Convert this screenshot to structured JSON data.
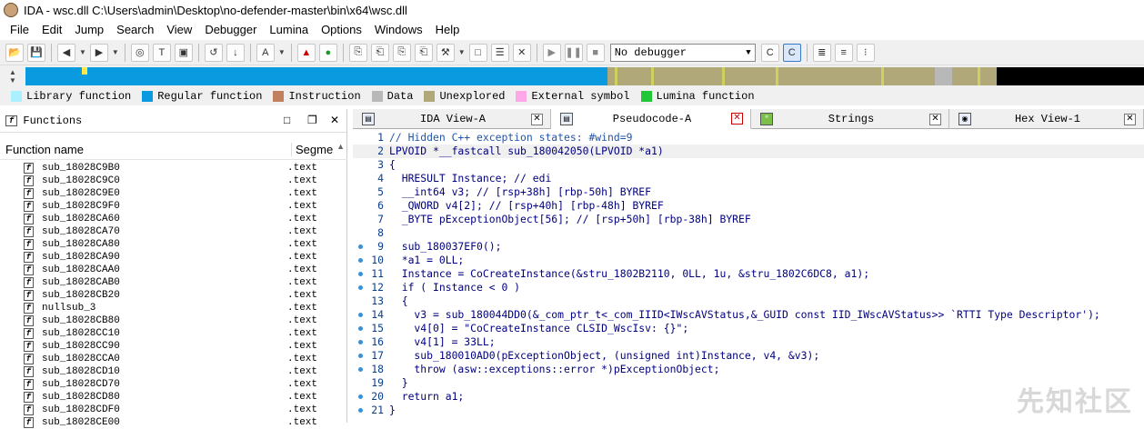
{
  "window": {
    "title": "IDA - wsc.dll C:\\Users\\admin\\Desktop\\no-defender-master\\bin\\x64\\wsc.dll"
  },
  "menu": [
    "File",
    "Edit",
    "Jump",
    "Search",
    "View",
    "Debugger",
    "Lumina",
    "Options",
    "Windows",
    "Help"
  ],
  "toolbar": {
    "debugger_value": "No debugger"
  },
  "legend": [
    {
      "label": "Library function",
      "color": "#aaf0ff"
    },
    {
      "label": "Regular function",
      "color": "#0a9ae0"
    },
    {
      "label": "Instruction",
      "color": "#c08060"
    },
    {
      "label": "Data",
      "color": "#b8b8b8"
    },
    {
      "label": "Unexplored",
      "color": "#b0a878"
    },
    {
      "label": "External symbol",
      "color": "#ffa8e8"
    },
    {
      "label": "Lumina function",
      "color": "#20c838"
    }
  ],
  "functions_panel": {
    "title": "Functions",
    "col_name": "Function name",
    "col_segment": "Segme",
    "rows": [
      {
        "name": "sub_18028C9B0",
        "seg": ".text"
      },
      {
        "name": "sub_18028C9C0",
        "seg": ".text"
      },
      {
        "name": "sub_18028C9E0",
        "seg": ".text"
      },
      {
        "name": "sub_18028C9F0",
        "seg": ".text"
      },
      {
        "name": "sub_18028CA60",
        "seg": ".text"
      },
      {
        "name": "sub_18028CA70",
        "seg": ".text"
      },
      {
        "name": "sub_18028CA80",
        "seg": ".text"
      },
      {
        "name": "sub_18028CA90",
        "seg": ".text"
      },
      {
        "name": "sub_18028CAA0",
        "seg": ".text"
      },
      {
        "name": "sub_18028CAB0",
        "seg": ".text"
      },
      {
        "name": "sub_18028CB20",
        "seg": ".text"
      },
      {
        "name": "nullsub_3",
        "seg": ".text"
      },
      {
        "name": "sub_18028CB80",
        "seg": ".text"
      },
      {
        "name": "sub_18028CC10",
        "seg": ".text"
      },
      {
        "name": "sub_18028CC90",
        "seg": ".text"
      },
      {
        "name": "sub_18028CCA0",
        "seg": ".text"
      },
      {
        "name": "sub_18028CD10",
        "seg": ".text"
      },
      {
        "name": "sub_18028CD70",
        "seg": ".text"
      },
      {
        "name": "sub_18028CD80",
        "seg": ".text"
      },
      {
        "name": "sub_18028CDF0",
        "seg": ".text"
      },
      {
        "name": "sub_18028CE00",
        "seg": ".text"
      }
    ]
  },
  "tabs": [
    {
      "label": "IDA View-A",
      "icon": "ida-view-icon",
      "active": false
    },
    {
      "label": "Pseudocode-A",
      "icon": "pseudocode-icon",
      "active": true
    },
    {
      "label": "Strings",
      "icon": "strings-icon",
      "active": false
    },
    {
      "label": "Hex View-1",
      "icon": "hex-view-icon",
      "active": false
    }
  ],
  "code_lines": [
    {
      "n": "1",
      "dot": false,
      "t": "// Hidden C++ exception states: #wind=9"
    },
    {
      "n": "2",
      "dot": false,
      "t": "LPVOID *__fastcall sub_180042050(LPVOID *a1)"
    },
    {
      "n": "3",
      "dot": false,
      "t": "{"
    },
    {
      "n": "4",
      "dot": false,
      "t": "  HRESULT Instance; // edi"
    },
    {
      "n": "5",
      "dot": false,
      "t": "  __int64 v3; // [rsp+38h] [rbp-50h] BYREF"
    },
    {
      "n": "6",
      "dot": false,
      "t": "  _QWORD v4[2]; // [rsp+40h] [rbp-48h] BYREF"
    },
    {
      "n": "7",
      "dot": false,
      "t": "  _BYTE pExceptionObject[56]; // [rsp+50h] [rbp-38h] BYREF"
    },
    {
      "n": "8",
      "dot": false,
      "t": ""
    },
    {
      "n": "9",
      "dot": true,
      "t": "  sub_180037EF0();"
    },
    {
      "n": "10",
      "dot": true,
      "t": "  *a1 = 0LL;"
    },
    {
      "n": "11",
      "dot": true,
      "t": "  Instance = CoCreateInstance(&stru_1802B2110, 0LL, 1u, &stru_1802C6DC8, a1);"
    },
    {
      "n": "12",
      "dot": true,
      "t": "  if ( Instance < 0 )"
    },
    {
      "n": "13",
      "dot": false,
      "t": "  {"
    },
    {
      "n": "14",
      "dot": true,
      "t": "    v3 = sub_180044DD0(&_com_ptr_t<_com_IIID<IWscAVStatus,&_GUID const IID_IWscAVStatus>> `RTTI Type Descriptor');"
    },
    {
      "n": "15",
      "dot": true,
      "t": "    v4[0] = \"CoCreateInstance CLSID_WscIsv: {}\";"
    },
    {
      "n": "16",
      "dot": true,
      "t": "    v4[1] = 33LL;"
    },
    {
      "n": "17",
      "dot": true,
      "t": "    sub_180010AD0(pExceptionObject, (unsigned int)Instance, v4, &v3);"
    },
    {
      "n": "18",
      "dot": true,
      "t": "    throw (asw::exceptions::error *)pExceptionObject;"
    },
    {
      "n": "19",
      "dot": false,
      "t": "  }"
    },
    {
      "n": "20",
      "dot": true,
      "t": "  return a1;"
    },
    {
      "n": "21",
      "dot": true,
      "t": "}"
    }
  ],
  "watermark": "先知社区"
}
